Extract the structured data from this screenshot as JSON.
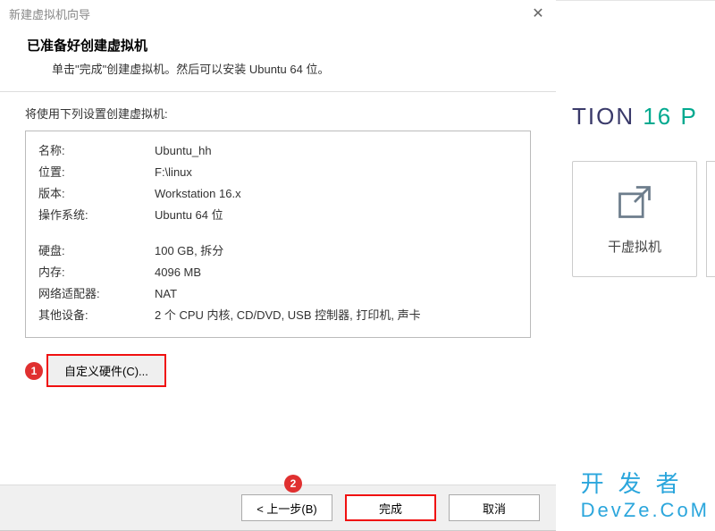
{
  "dialog": {
    "title": "新建虚拟机向导",
    "heading": "已准备好创建虚拟机",
    "subtitle": "单击\"完成\"创建虚拟机。然后可以安装 Ubuntu 64 位。",
    "settings_label": "将使用下列设置创建虚拟机:",
    "rows": [
      {
        "k": "名称:",
        "v": "Ubuntu_hh"
      },
      {
        "k": "位置:",
        "v": "F:\\linux"
      },
      {
        "k": "版本:",
        "v": "Workstation 16.x"
      },
      {
        "k": "操作系统:",
        "v": "Ubuntu 64 位"
      }
    ],
    "rows2": [
      {
        "k": "硬盘:",
        "v": "100 GB, 拆分"
      },
      {
        "k": "内存:",
        "v": "4096 MB"
      },
      {
        "k": "网络适配器:",
        "v": "NAT"
      },
      {
        "k": "其他设备:",
        "v": "2 个 CPU 内核, CD/DVD, USB 控制器, 打印机, 声卡"
      }
    ],
    "customize_btn": "自定义硬件(C)...",
    "back_btn": "< 上一步(B)",
    "finish_btn": "完成",
    "cancel_btn": "取消",
    "marker1": "1",
    "marker2": "2"
  },
  "background": {
    "brand_part1": "TION ",
    "brand_part2": "16 P",
    "tile_label": "干虚拟机"
  },
  "watermark": {
    "line1": "开发者",
    "line2": "DevZe.CoM"
  }
}
